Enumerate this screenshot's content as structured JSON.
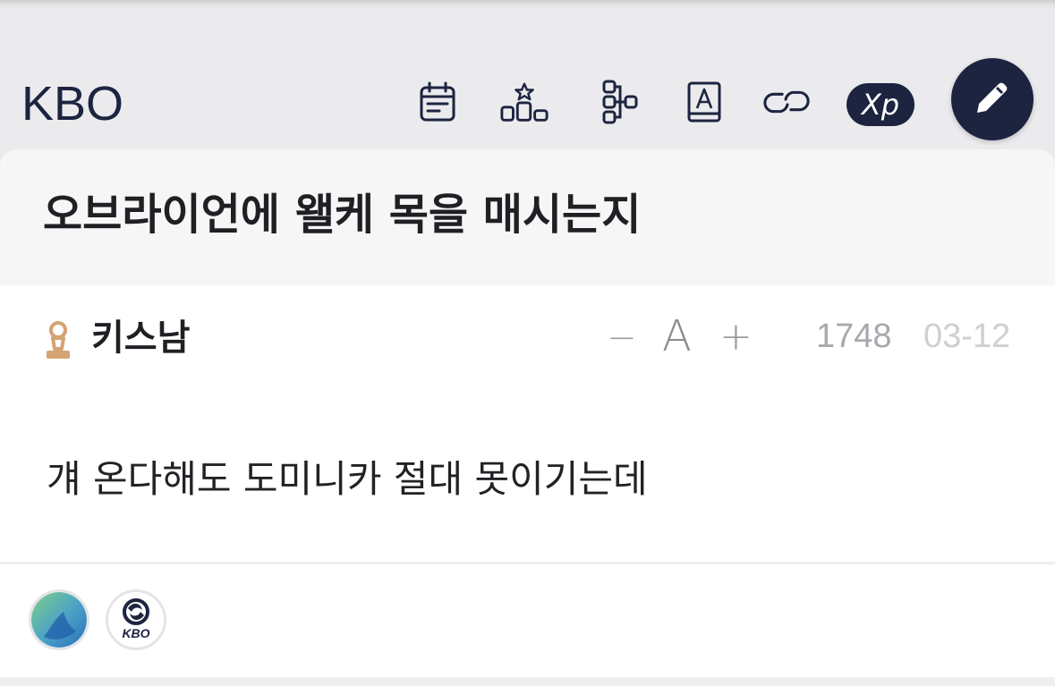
{
  "header": {
    "brand": "KBO",
    "icons": [
      "calendar-icon",
      "ranking-icon",
      "bracket-icon",
      "dictionary-icon",
      "link-icon"
    ],
    "xp_label": "Xp",
    "write_button_icon": "pencil-icon",
    "accent_color": "#1c2440",
    "background_color": "#ebebed"
  },
  "post": {
    "title": "오브라이언에 왤케 목을 매시는지",
    "author": "키스남",
    "rank_icon": "pawn-rank-icon",
    "rank_color": "#d4a373",
    "font_controls": {
      "decrease": "−",
      "label": "A",
      "increase": "+"
    },
    "views": "1748",
    "date": "03-12",
    "body": "걔 온다해도 도미니카 절대 못이기는데"
  },
  "reactions": {
    "avatars": [
      {
        "name": "green-blue-avatar"
      },
      {
        "name": "kbo-badge-avatar",
        "badge_text": "KBO"
      }
    ]
  }
}
